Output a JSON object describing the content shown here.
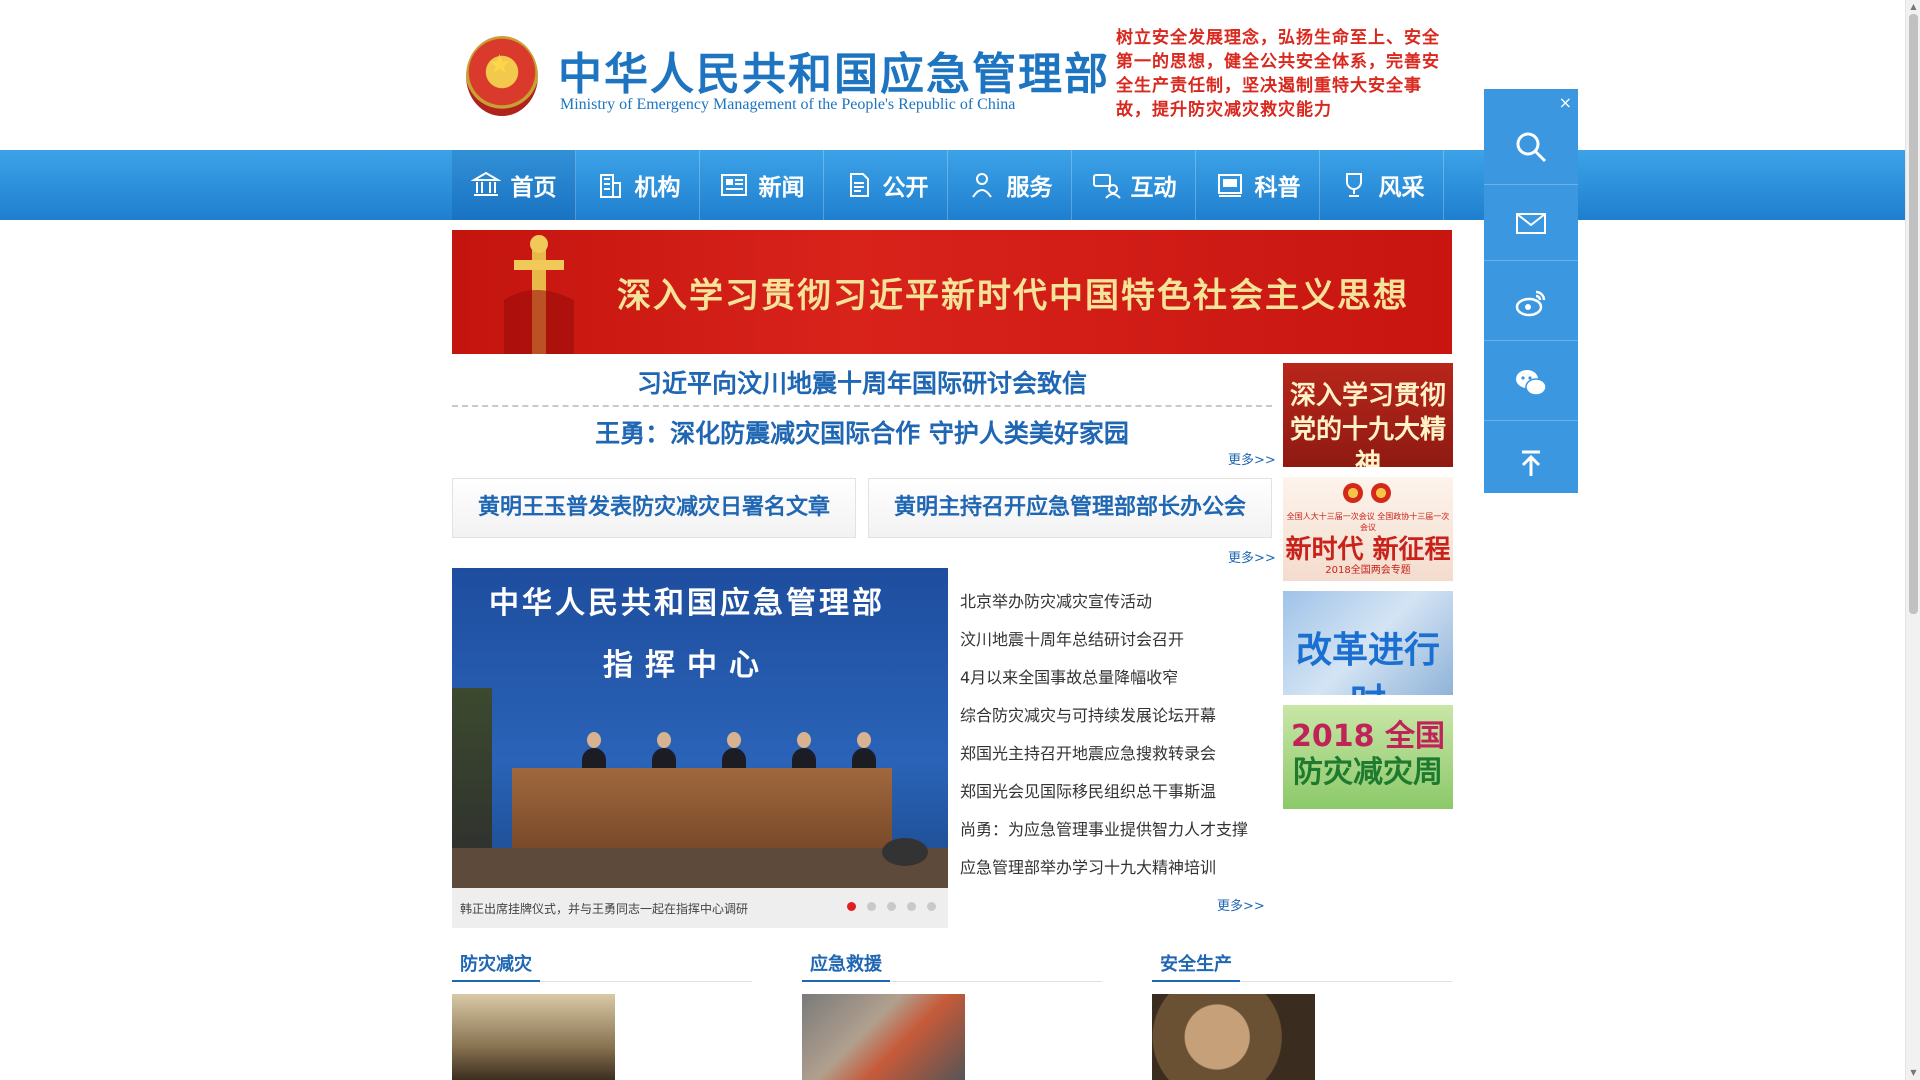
{
  "header": {
    "title_cn": "中华人民共和国应急管理部",
    "title_en": "Ministry of Emergency Management of the People's Republic of China",
    "slogan": "树立安全发展理念，弘扬生命至上、安全第一的思想，健全公共安全体系，完善安全生产责任制，坚决遏制重特大安全事故，提升防灾减灾救灾能力"
  },
  "nav": {
    "items": [
      {
        "label": "首页",
        "icon": "building-columns-icon"
      },
      {
        "label": "机构",
        "icon": "office-building-icon"
      },
      {
        "label": "新闻",
        "icon": "newspaper-icon"
      },
      {
        "label": "公开",
        "icon": "document-icon"
      },
      {
        "label": "服务",
        "icon": "service-person-icon"
      },
      {
        "label": "互动",
        "icon": "chat-people-icon"
      },
      {
        "label": "科普",
        "icon": "book-icon"
      },
      {
        "label": "风采",
        "icon": "trophy-icon"
      }
    ]
  },
  "banner": {
    "text": "深入学习贯彻习近平新时代中国特色社会主义思想"
  },
  "headlines": {
    "top": "习近平向汶川地震十周年国际研讨会致信",
    "second": "王勇：深化防震减灾国际合作 守护人类美好家园",
    "more": "更多>>",
    "box_left": "黄明王玉普发表防灾减灾日署名文章",
    "box_right": "黄明主持召开应急管理部部长办公会",
    "box_more": "更多>>"
  },
  "slider": {
    "photo_title": "中华人民共和国应急管理部",
    "photo_subtitle": "指挥中心",
    "caption": "韩正出席挂牌仪式，并与王勇同志一起在指挥中心调研",
    "dot_count": 5,
    "active_dot": 1
  },
  "news_list": {
    "items": [
      "北京举办防灾减灾宣传活动",
      "汶川地震十周年总结研讨会召开",
      "4月以来全国事故总量降幅收窄",
      "综合防灾减灾与可持续发展论坛开幕",
      "郑国光主持召开地震应急搜救转录会",
      "郑国光会见国际移民组织总干事斯温",
      "尚勇：为应急管理事业提供智力人才支撑",
      "应急管理部举办学习十九大精神培训"
    ],
    "more": "更多>>"
  },
  "thumbs": {
    "t1": "深入学习贯彻党的十九大精神",
    "t2_small": "全国人大十三届一次会议 全国政协十三届一次会议",
    "t2_main": "新时代 新征程",
    "t2_sub": "2018全国两会专题",
    "t3": "改革进行时",
    "t4_line1": "2018 全国",
    "t4_line2": "防灾减灾周"
  },
  "columns": [
    {
      "title": "防灾减灾"
    },
    {
      "title": "应急救援"
    },
    {
      "title": "安全生产"
    }
  ],
  "side_panel": {
    "close": "×",
    "buttons": [
      "search-icon",
      "mail-icon",
      "weibo-icon",
      "wechat-icon",
      "back-to-top-icon"
    ]
  },
  "colors": {
    "brand_blue": "#1d74c1",
    "nav_blue": "#2a8ad8",
    "slogan_red": "#d9281e",
    "banner_red": "#c81510",
    "side_panel_blue": "#3a97e0"
  }
}
